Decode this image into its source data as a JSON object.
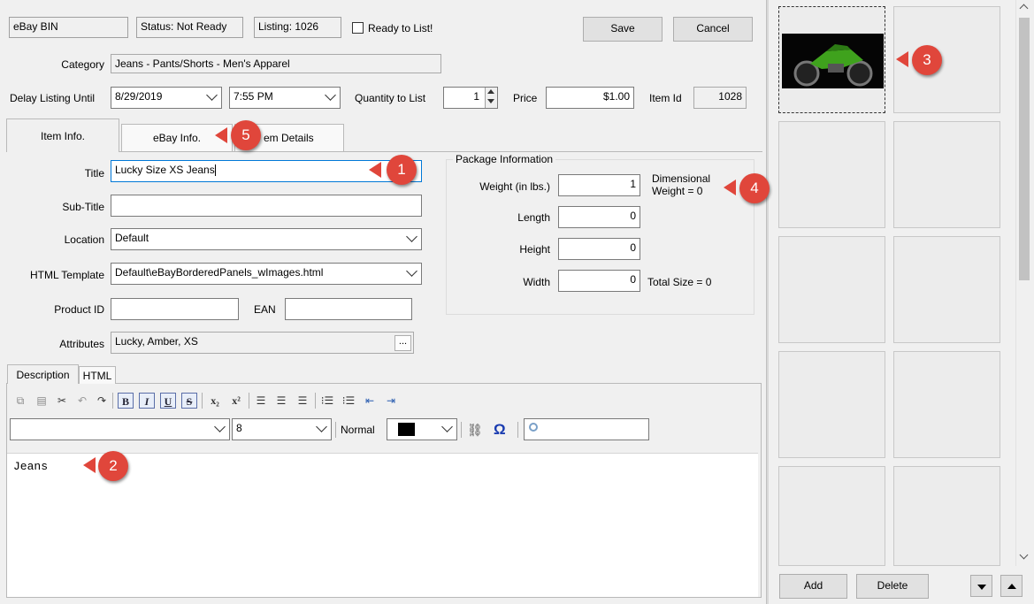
{
  "header": {
    "listing_type": "eBay BIN",
    "status": "Status: Not Ready",
    "listing": "Listing: 1026",
    "ready_label": "Ready to List!",
    "save_label": "Save",
    "cancel_label": "Cancel"
  },
  "category": {
    "label": "Category",
    "value": "Jeans - Pants/Shorts - Men's Apparel"
  },
  "schedule": {
    "delay_label": "Delay Listing Until",
    "date": "8/29/2019",
    "time": "7:55 PM",
    "qty_label": "Quantity to List",
    "qty": "1",
    "price_label": "Price",
    "price": "$1.00",
    "item_id_label": "Item Id",
    "item_id": "1028"
  },
  "tabs": [
    "Item Info.",
    "eBay Info.",
    "Item Details"
  ],
  "tab_partial": "em Details",
  "form": {
    "title_label": "Title",
    "title_value": "Lucky Size XS Jeans",
    "subtitle_label": "Sub-Title",
    "subtitle_value": "",
    "location_label": "Location",
    "location_value": "Default",
    "template_label": "HTML Template",
    "template_value": "Default\\eBayBorderedPanels_wImages.html",
    "product_id_label": "Product ID",
    "product_id_value": "",
    "ean_label": "EAN",
    "ean_value": "",
    "attributes_label": "Attributes",
    "attributes_value": "Lucky, Amber, XS",
    "ellipsis": "..."
  },
  "package": {
    "title": "Package Information",
    "weight_label": "Weight (in lbs.)",
    "weight": "1",
    "dim_weight_line1": "Dimensional",
    "dim_weight_line2": "Weight = 0",
    "length_label": "Length",
    "length": "0",
    "height_label": "Height",
    "height": "0",
    "width_label": "Width",
    "width": "0",
    "total_size": "Total Size = 0"
  },
  "editor": {
    "tab_description": "Description",
    "tab_html": "HTML",
    "font_name": "",
    "font_size": "8",
    "style": "Normal",
    "find_value": "",
    "content": "Jeans"
  },
  "images_panel": {
    "add_label": "Add",
    "delete_label": "Delete"
  },
  "badges": [
    "1",
    "2",
    "3",
    "4",
    "5"
  ],
  "colors": {
    "badge": "#e0463b",
    "focus": "#0078d7",
    "bike_green": "#3fa21d"
  }
}
